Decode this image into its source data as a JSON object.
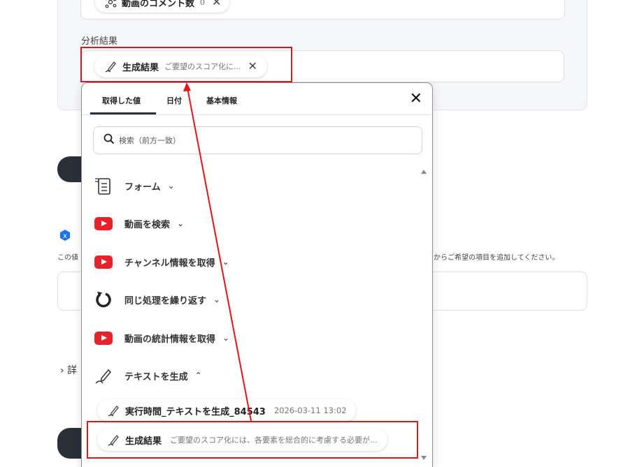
{
  "top_field": {
    "chip_label": "動画のコメント数",
    "chip_value": "0"
  },
  "analysis": {
    "label": "分析結果",
    "chip_label": "生成結果",
    "chip_value": "ご要望のスコア化に..."
  },
  "background": {
    "notice_text": "この値",
    "notice_tail": "からご希望の項目を追加してください。",
    "details_label": "詳"
  },
  "popup": {
    "tabs": [
      {
        "label": "取得した値"
      },
      {
        "label": "日付"
      },
      {
        "label": "基本情報"
      }
    ],
    "close": "✕",
    "search_placeholder": "検索（前方一致）",
    "items": [
      {
        "label": "フォーム",
        "icon": "form-icon",
        "chevron": "⌄"
      },
      {
        "label": "動画を検索",
        "icon": "youtube-icon",
        "chevron": "⌄"
      },
      {
        "label": "チャンネル情報を取得",
        "icon": "youtube-icon",
        "chevron": "⌄"
      },
      {
        "label": "同じ処理を繰り返す",
        "icon": "loop-icon",
        "chevron": "⌄"
      },
      {
        "label": "動画の統計情報を取得",
        "icon": "youtube-icon",
        "chevron": "⌄"
      },
      {
        "label": "テキストを生成",
        "icon": "text-generate-icon",
        "chevron": "⌃"
      }
    ],
    "sub_items": [
      {
        "label": "実行時間_テキストを生成_84543",
        "value": "2026-03-11 13:02"
      },
      {
        "label": "生成結果",
        "value": "ご要望のスコア化には、各要素を総合的に考慮する必要が..."
      }
    ]
  },
  "colors": {
    "accent_dark": "#2b2f38",
    "youtube_red": "#e8222a",
    "annotation_red": "#e0151b",
    "info_blue": "#1a73e8"
  }
}
